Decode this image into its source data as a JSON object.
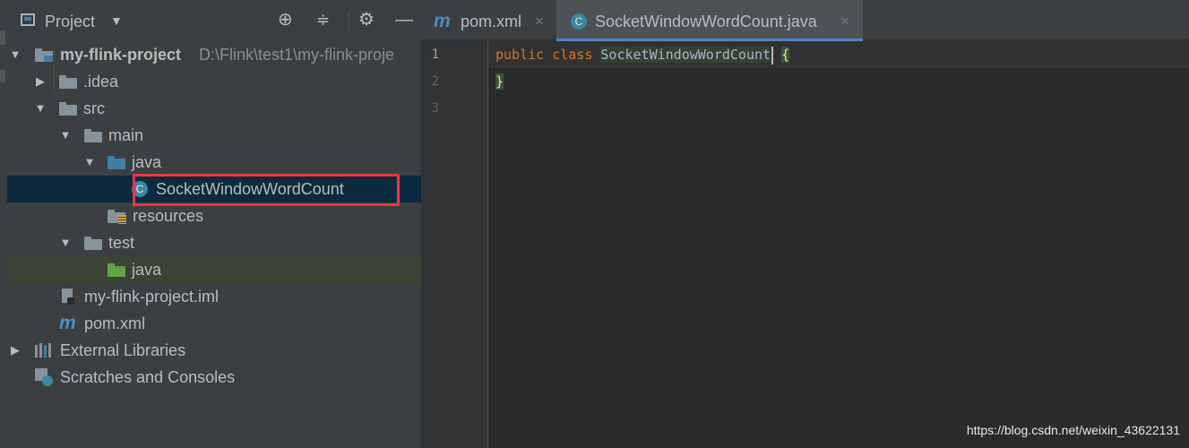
{
  "sidebar": {
    "title": "Project",
    "tree": {
      "root_name": "my-flink-project",
      "root_path": "D:\\Flink\\test1\\my-flink-proje",
      "idea": ".idea",
      "src": "src",
      "main": "main",
      "main_java": "java",
      "class_file": "SocketWindowWordCount",
      "class_badge": "C",
      "resources": "resources",
      "test": "test",
      "test_java": "java",
      "iml": "my-flink-project.iml",
      "pom_icon": "m",
      "pom": "pom.xml",
      "external_libraries": "External Libraries",
      "scratches": "Scratches and Consoles"
    }
  },
  "editor": {
    "tabs": [
      {
        "icon": "m",
        "label": "pom.xml",
        "close": "×"
      },
      {
        "icon": "C",
        "label": "SocketWindowWordCount.java",
        "close": "×"
      }
    ],
    "line_numbers": [
      "1",
      "2",
      "3"
    ],
    "code": {
      "kw_public": "public",
      "kw_class": "class",
      "class_name": "SocketWindowWordCount",
      "open_brace": "{",
      "close_brace": "}"
    }
  },
  "watermark": "https://blog.csdn.net/weixin_43622131",
  "colors": {
    "sidebar_bg": "#3c3f41",
    "editor_bg": "#2b2b2b",
    "selection": "#0d293e",
    "highlight_box": "#e8383d",
    "keyword": "#cc7832",
    "folder_blue": "#3d7fa6",
    "folder_green": "#62a34a",
    "active_tab_underline": "#4a88c7"
  },
  "icons": [
    "project-view-icon",
    "locate-icon",
    "collapse-all-icon",
    "settings-gear-icon",
    "hide-icon",
    "folder-icon",
    "module-folder-icon",
    "source-folder-icon",
    "test-source-folder-icon",
    "resources-folder-icon",
    "java-class-icon",
    "maven-icon",
    "iml-file-icon",
    "libraries-icon",
    "scratches-icon"
  ]
}
